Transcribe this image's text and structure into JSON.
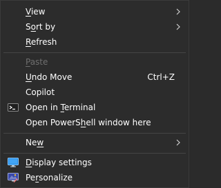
{
  "menu": {
    "view": {
      "pre": "",
      "u": "V",
      "post": "iew"
    },
    "sort_by": {
      "pre": "S",
      "u": "o",
      "post": "rt by"
    },
    "refresh": {
      "pre": "",
      "u": "R",
      "post": "efresh"
    },
    "paste": {
      "pre": "",
      "u": "P",
      "post": "aste"
    },
    "undo_move": {
      "pre": "",
      "u": "U",
      "post": "ndo Move",
      "shortcut": "Ctrl+Z"
    },
    "copilot": {
      "pre": "Copilot",
      "u": "",
      "post": ""
    },
    "open_terminal": {
      "pre": "Open in ",
      "u": "T",
      "post": "erminal"
    },
    "open_powershell": {
      "pre": "Open PowerS",
      "u": "h",
      "post": "ell window here"
    },
    "new": {
      "pre": "Ne",
      "u": "w",
      "post": ""
    },
    "display_settings": {
      "pre": "",
      "u": "D",
      "post": "isplay settings"
    },
    "personalize": {
      "pre": "Pe",
      "u": "r",
      "post": "sonalize"
    }
  },
  "icons": {
    "terminal": "terminal-icon",
    "display": "display-settings-icon",
    "personalize": "personalize-icon",
    "submenu": "chevron-right-icon"
  },
  "colors": {
    "menu_bg": "#2c2c2c",
    "text": "#ffffff",
    "disabled_text": "#6f6f6f",
    "separator": "#454545"
  }
}
